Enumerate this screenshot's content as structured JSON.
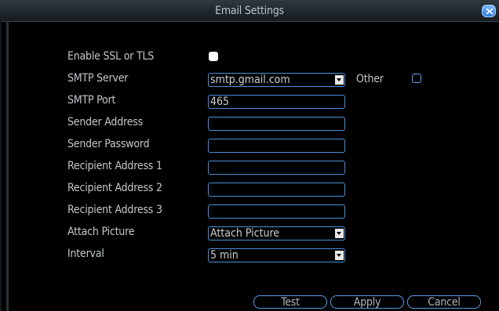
{
  "window": {
    "title": "Email Settings"
  },
  "form": {
    "ssl": {
      "label": "Enable SSL or TLS",
      "checked": true
    },
    "smtp_server": {
      "label": "SMTP Server",
      "value": "smtp.gmail.com"
    },
    "other": {
      "label": "Other",
      "checked": false
    },
    "smtp_port": {
      "label": "SMTP Port",
      "value": "465"
    },
    "sender_address": {
      "label": "Sender Address",
      "value": ""
    },
    "sender_password": {
      "label": "Sender Password",
      "value": ""
    },
    "recipient_1": {
      "label": "Recipient Address 1",
      "value": ""
    },
    "recipient_2": {
      "label": "Recipient Address 2",
      "value": ""
    },
    "recipient_3": {
      "label": "Recipient Address 3",
      "value": ""
    },
    "attach_picture": {
      "label": "Attach Picture",
      "value": "Attach Picture"
    },
    "interval": {
      "label": "Interval",
      "value": "5 min"
    }
  },
  "buttons": {
    "test": "Test",
    "apply": "Apply",
    "cancel": "Cancel"
  },
  "colors": {
    "accent": "#4a8fdc",
    "background": "#000000",
    "text": "#c2c7cb"
  }
}
